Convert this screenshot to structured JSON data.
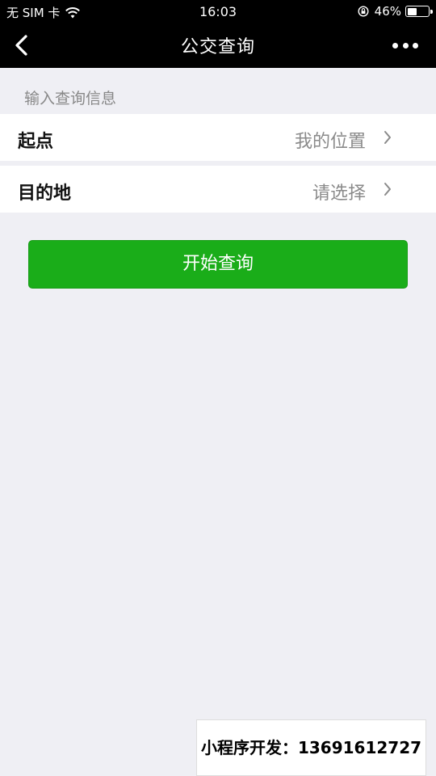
{
  "status_bar": {
    "carrier": "无 SIM 卡",
    "time": "16:03",
    "battery": "46%",
    "battery_level": 0.46,
    "icons": [
      "wifi-icon",
      "orientation-lock-icon",
      "battery-icon"
    ]
  },
  "nav": {
    "title": "公交查询",
    "back_icon": "chevron-left-icon",
    "more_icon": "more-dots-icon"
  },
  "form": {
    "section_title": "输入查询信息",
    "start": {
      "label": "起点",
      "value": "我的位置"
    },
    "destination": {
      "label": "目的地",
      "value": "请选择"
    },
    "submit_label": "开始查询"
  },
  "colors": {
    "nav_background": "#000000",
    "page_background": "#efeff4",
    "button_green": "#1aad19"
  },
  "watermark": {
    "text": "小程序开发：13691612727"
  }
}
